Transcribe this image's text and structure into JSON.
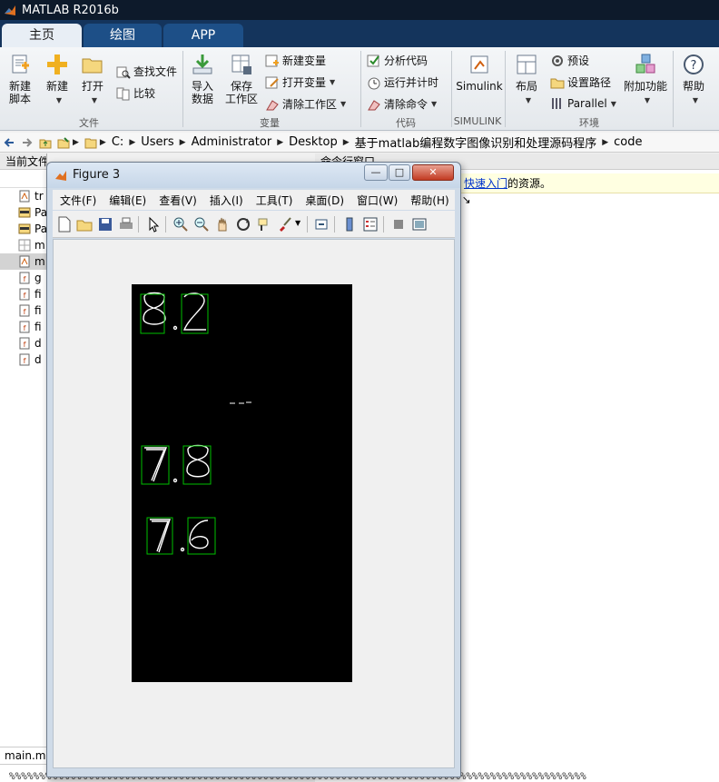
{
  "app": {
    "title": "MATLAB R2016b"
  },
  "tabs": [
    {
      "label": "主页",
      "active": true
    },
    {
      "label": "绘图",
      "active": false
    },
    {
      "label": "APP",
      "active": false
    }
  ],
  "ribbon": {
    "file": {
      "group_label": "文件",
      "new_script": [
        "新建",
        "脚本"
      ],
      "new": "新建",
      "open": "打开",
      "find_files": "查找文件",
      "compare": "比较"
    },
    "variable": {
      "group_label": "变量",
      "import_data": [
        "导入",
        "数据"
      ],
      "save_workspace": [
        "保存",
        "工作区"
      ],
      "new_variable": "新建变量",
      "open_variable": "打开变量",
      "clear_workspace": "清除工作区"
    },
    "code": {
      "group_label": "代码",
      "analyze_code": "分析代码",
      "run_and_time": "运行并计时",
      "clear_commands": "清除命令"
    },
    "simulink": {
      "group_label": "SIMULINK",
      "simulink": "Simulink"
    },
    "environment": {
      "group_label": "环境",
      "layout": "布局",
      "preferences": "预设",
      "set_path": "设置路径",
      "parallel": "Parallel",
      "addons": "附加功能",
      "help": "帮助"
    }
  },
  "address": {
    "crumbs": [
      "C:",
      "Users",
      "Administrator",
      "Desktop",
      "基于matlab编程数字图像识别和处理源码程序",
      "code"
    ]
  },
  "current_folder": {
    "header": "当前文件夹",
    "files": [
      {
        "label": "tr",
        "icon": "m-file-icon",
        "selected": false
      },
      {
        "label": "Pa",
        "icon": "jpg-file-icon",
        "selected": false
      },
      {
        "label": "Pa",
        "icon": "jpg-file-icon",
        "selected": false
      },
      {
        "label": "m",
        "icon": "fig-file-icon",
        "selected": false
      },
      {
        "label": "m",
        "icon": "m-file-icon",
        "selected": true
      },
      {
        "label": "g",
        "icon": "func-file-icon",
        "selected": false
      },
      {
        "label": "fi",
        "icon": "func-file-icon",
        "selected": false
      },
      {
        "label": "fi",
        "icon": "func-file-icon",
        "selected": false
      },
      {
        "label": "fi",
        "icon": "func-file-icon",
        "selected": false
      },
      {
        "label": "d",
        "icon": "func-file-icon",
        "selected": false
      },
      {
        "label": "d",
        "icon": "func-file-icon",
        "selected": false
      }
    ],
    "details_file": "main.m"
  },
  "command_window": {
    "header": "命令行窗口",
    "info_link": "快速入门",
    "info_suffix": "的资源。"
  },
  "footer_text": "%%%%%%%%%%%%%%%%%%%%%%%%%%%%%%%%%%%%%%%%%%%%%%%%%%%%%%%%%%%%%%%%%%%%%%%%%%%%%%%%%%%%%%%%%%%%%%%%",
  "figure": {
    "title": "Figure 3",
    "window_buttons": [
      "—",
      "□",
      "✕"
    ],
    "menu": [
      "文件(F)",
      "编辑(E)",
      "查看(V)",
      "插入(I)",
      "工具(T)",
      "桌面(D)",
      "窗口(W)",
      "帮助(H)"
    ],
    "menu_overflow": "↘",
    "digits": [
      "8.2",
      "7.8",
      "7.6"
    ],
    "box_color": "#00c000"
  }
}
